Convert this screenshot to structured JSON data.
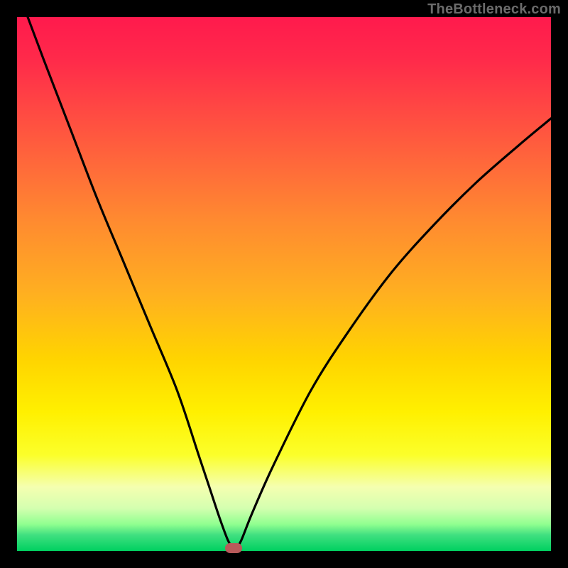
{
  "watermark": "TheBottleneck.com",
  "colors": {
    "curve_stroke": "#000000",
    "marker_fill": "#b85a5a",
    "frame_bg": "#000000"
  },
  "chart_data": {
    "type": "line",
    "title": "",
    "xlabel": "",
    "ylabel": "",
    "xlim": [
      0,
      100
    ],
    "ylim": [
      0,
      100
    ],
    "grid": false,
    "legend": false,
    "series": [
      {
        "name": "bottleneck-curve",
        "x": [
          2,
          5,
          10,
          15,
          20,
          25,
          30,
          34,
          36,
          38,
          39.5,
          40.5,
          41,
          42,
          44,
          48,
          55,
          62,
          70,
          78,
          86,
          94,
          100
        ],
        "y": [
          100,
          92,
          79,
          66,
          54,
          42,
          30,
          18,
          12,
          6,
          2,
          0.5,
          0.5,
          2,
          7,
          16,
          30,
          41,
          52,
          61,
          69,
          76,
          81
        ]
      }
    ],
    "flat_bottom": {
      "x_start": 39.5,
      "x_end": 41,
      "y": 0.5
    },
    "marker": {
      "x": 40.5,
      "y": 0.5
    },
    "gradient_stops": [
      {
        "pos": 0,
        "color": "#ff1a4d"
      },
      {
        "pos": 50,
        "color": "#ffb020"
      },
      {
        "pos": 75,
        "color": "#fff000"
      },
      {
        "pos": 100,
        "color": "#00d060"
      }
    ]
  }
}
